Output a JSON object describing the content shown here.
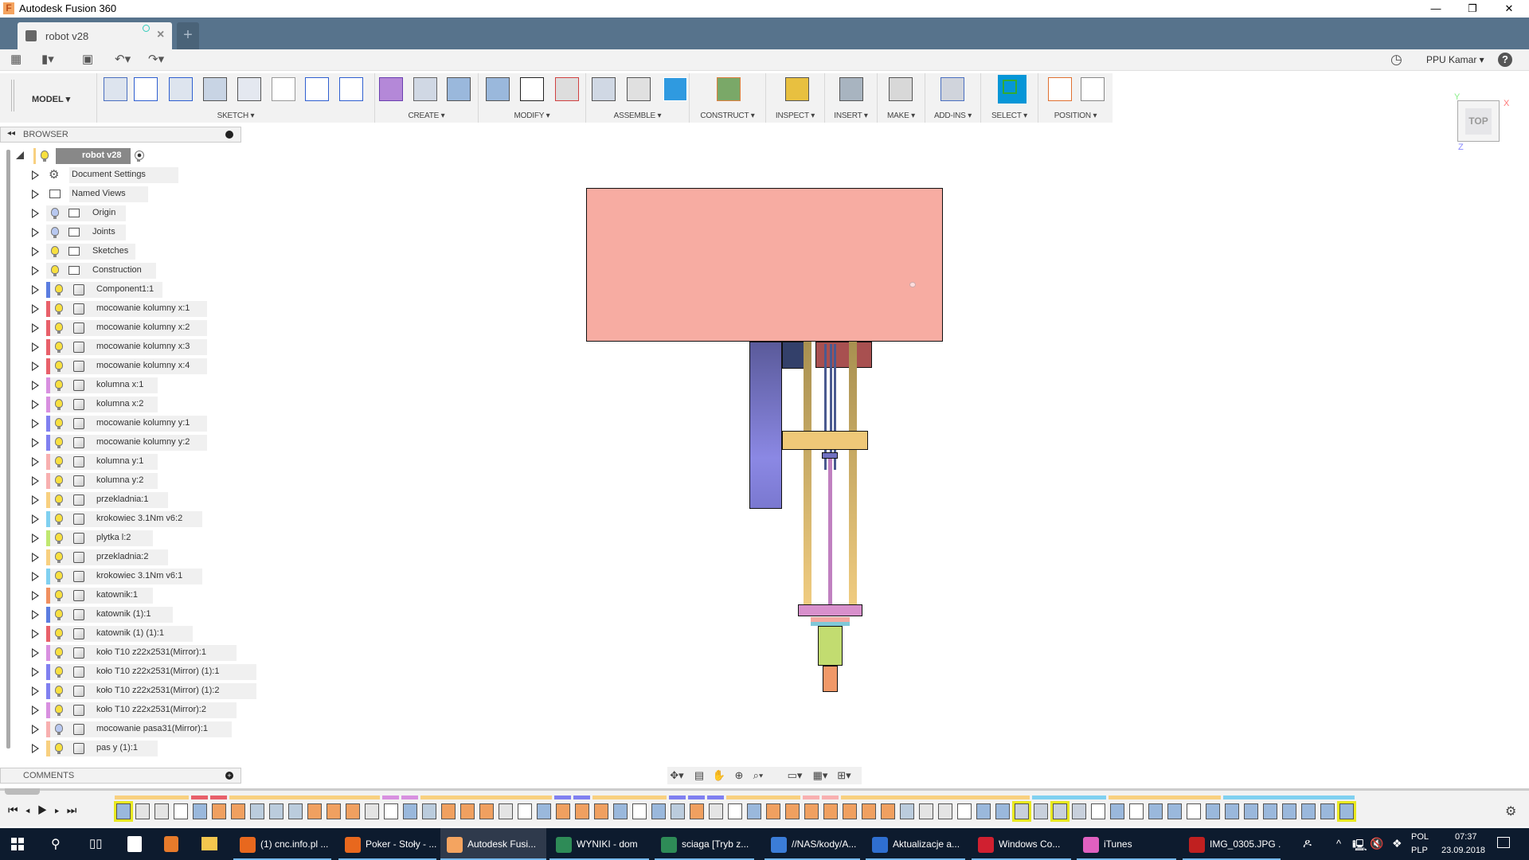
{
  "window": {
    "title": "Autodesk Fusion 360",
    "minimize": "—",
    "restore": "❐",
    "close": "✕"
  },
  "tabs": [
    {
      "label": "robot v28"
    }
  ],
  "new_tab": "+",
  "user": {
    "name": "PPU Kamar ▾",
    "help": "?"
  },
  "ribbon": {
    "workspace": "MODEL ▾",
    "groups": [
      {
        "label": "SKETCH ▾"
      },
      {
        "label": "CREATE ▾"
      },
      {
        "label": "MODIFY ▾"
      },
      {
        "label": "ASSEMBLE ▾"
      },
      {
        "label": "CONSTRUCT ▾"
      },
      {
        "label": "INSPECT ▾"
      },
      {
        "label": "INSERT ▾"
      },
      {
        "label": "MAKE ▾"
      },
      {
        "label": "ADD-INS ▾"
      },
      {
        "label": "SELECT ▾"
      },
      {
        "label": "POSITION ▾"
      }
    ]
  },
  "browser": {
    "title": "BROWSER",
    "root": "robot v28",
    "folders": [
      {
        "label": "Document Settings",
        "icon": "gear-icon"
      },
      {
        "label": "Named Views",
        "icon": "folder-icon"
      },
      {
        "label": "Origin",
        "bulb": "off"
      },
      {
        "label": "Joints",
        "bulb": "off"
      },
      {
        "label": "Sketches",
        "bulb": "on"
      },
      {
        "label": "Construction",
        "bulb": "on"
      }
    ],
    "components": [
      {
        "label": "Component1:1",
        "color": "#5b7de0"
      },
      {
        "label": "mocowanie kolumny x:1",
        "color": "#e8606a"
      },
      {
        "label": "mocowanie kolumny x:2",
        "color": "#e8606a"
      },
      {
        "label": "mocowanie kolumny x:3",
        "color": "#e8606a"
      },
      {
        "label": "mocowanie kolumny x:4",
        "color": "#e8606a"
      },
      {
        "label": "kolumna x:1",
        "color": "#d890e0"
      },
      {
        "label": "kolumna x:2",
        "color": "#d890e0"
      },
      {
        "label": "mocowanie kolumny y:1",
        "color": "#8080f0"
      },
      {
        "label": "mocowanie kolumny y:2",
        "color": "#8080f0"
      },
      {
        "label": "kolumna y:1",
        "color": "#f8b0b0"
      },
      {
        "label": "kolumna y:2",
        "color": "#f8b0b0"
      },
      {
        "label": "przekladnia:1",
        "color": "#f8d080"
      },
      {
        "label": "krokowiec 3.1Nm v6:2",
        "color": "#80d0f0"
      },
      {
        "label": "plytka l:2",
        "color": "#c0e870"
      },
      {
        "label": "przekladnia:2",
        "color": "#f8d080"
      },
      {
        "label": "krokowiec 3.1Nm v6:1",
        "color": "#80d0f0"
      },
      {
        "label": "katownik:1",
        "color": "#f09060"
      },
      {
        "label": "katownik (1):1",
        "color": "#5b7de0"
      },
      {
        "label": "katownik (1) (1):1",
        "color": "#e8606a"
      },
      {
        "label": "koło T10 z22x2531(Mirror):1",
        "color": "#d890e0"
      },
      {
        "label": "koło T10 z22x2531(Mirror) (1):1",
        "color": "#8080f0"
      },
      {
        "label": "koło T10 z22x2531(Mirror) (1):2",
        "color": "#8080f0"
      },
      {
        "label": "koło T10 z22x2531(Mirror):2",
        "color": "#d890e0"
      },
      {
        "label": "mocowanie pasa31(Mirror):1",
        "color": "#f8b0b0",
        "bulb": "off"
      },
      {
        "label": "pas y (1):1",
        "color": "#f8d080"
      }
    ]
  },
  "comments": {
    "title": "COMMENTS"
  },
  "viewcube": {
    "face": "TOP",
    "x": "X",
    "y": "Y",
    "z": "Z"
  },
  "taskbar": {
    "items": [
      {
        "label": "(1) cnc.info.pl ...",
        "color": "#e8681e"
      },
      {
        "label": "Poker - Stoły - ...",
        "color": "#e8681e"
      },
      {
        "label": "Autodesk Fusi...",
        "color": "#f4a460"
      },
      {
        "label": "WYNIKI - dom",
        "color": "#2e8b57"
      },
      {
        "label": "sciaga  [Tryb z...",
        "color": "#2e8b57"
      },
      {
        "label": "//NAS/kody/A...",
        "color": "#3b7dd8"
      },
      {
        "label": "Aktualizacje a...",
        "color": "#2f6fd0"
      },
      {
        "label": "Windows Co...",
        "color": "#d02030"
      },
      {
        "label": "iTunes",
        "color": "#e060c0"
      },
      {
        "label": "IMG_0305.JPG ...",
        "color": "#c02020"
      }
    ],
    "lang_top": "POL",
    "lang_bottom": "PLP",
    "time": "07:37",
    "date": "23.09.2018"
  },
  "colors": {
    "tabbar": "#57738c",
    "select_active": "#0696d7",
    "taskbar": "#0d1b2e"
  }
}
